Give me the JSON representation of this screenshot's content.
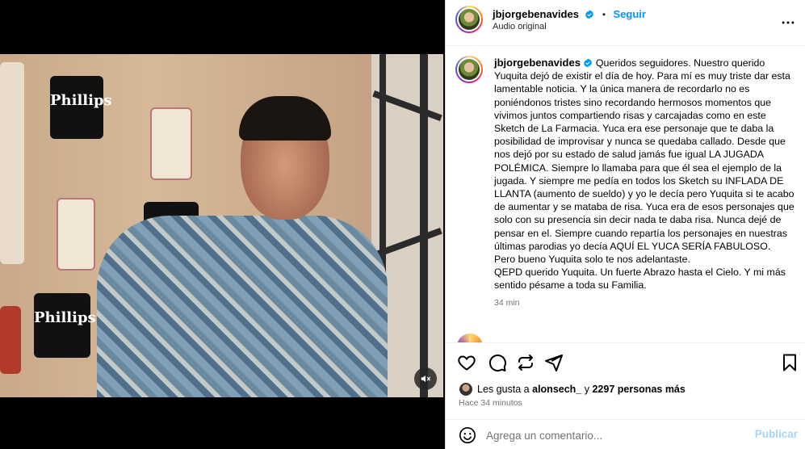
{
  "post": {
    "author": "jbjorgebenavides",
    "follow_label": "Seguir",
    "separator": "•",
    "audio": "Audio original"
  },
  "caption": {
    "author": "jbjorgebenavides",
    "text": "Queridos seguidores. Nuestro querido Yuquita dejó de existir el día de hoy. Para mí es muy triste dar esta lamentable noticia. Y la única manera de recordarlo no es poniéndonos tristes sino recordando hermosos momentos que vivimos juntos compartiendo risas y carcajadas como en este Sketch de La Farmacia. Yuca era ese personaje que te daba la posibilidad de improvisar y nunca se quedaba callado. Desde que nos dejó por su estado de salud jamás fue igual LA JUGADA POLÉMICA. Siempre lo llamaba para que él sea el ejemplo de la jugada. Y siempre me pedía en todos los Sketch su INFLADA DE LLANTA (aumento de sueldo) y yo le decía pero Yuquita si te acabo de aumentar y se mataba de risa. Yuca era de esos personajes que solo con su presencia sin decir nada te daba risa. Nunca dejé de pensar en el. Siempre cuando repartía los personajes en nuestras últimas parodias yo decía AQUÍ EL YUCA SERÍA FABULOSO.",
    "line2": "Pero bueno Yuquita solo te nos adelantaste.",
    "line3": "QEPD querido Yuquita. Un fuerte Abrazo hasta el Cielo. Y mi más sentido pésame a toda su Familia.",
    "time": "34 min"
  },
  "video": {
    "sign_text": "Phillips"
  },
  "likes": {
    "prefix": "Les gusta a",
    "user": "alonsech_",
    "connector": "y",
    "others": "2297 personas más"
  },
  "posted_ago": "Hace 34 minutos",
  "comment_box": {
    "placeholder": "Agrega un comentario...",
    "publish_label": "Publicar"
  },
  "colors": {
    "accent": "#0095f6",
    "publish_disabled": "#a7d4fb",
    "muted_text": "#737373"
  },
  "icons": [
    "verified-badge-icon",
    "more-options-icon",
    "mute-icon",
    "heart-icon",
    "comment-icon",
    "share-icon",
    "send-icon",
    "bookmark-icon",
    "emoji-icon"
  ]
}
